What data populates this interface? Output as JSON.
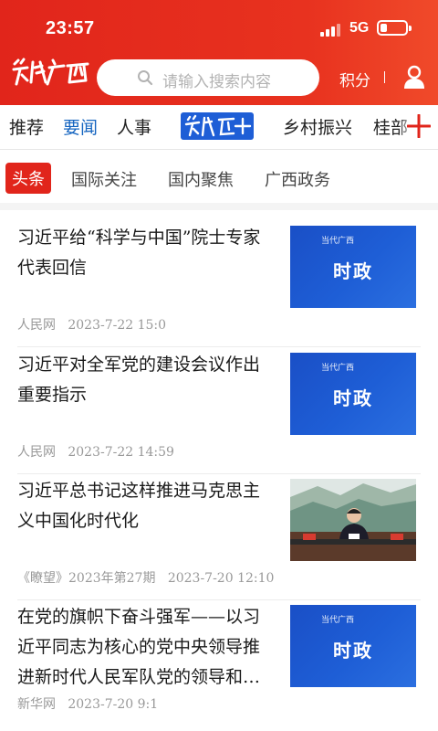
{
  "status": {
    "time": "23:57",
    "network": "5G"
  },
  "header": {
    "logo_text": "当代广西",
    "search_placeholder": "请输入搜索内容",
    "points_label": "积分"
  },
  "channels": {
    "items": [
      "推荐",
      "要闻",
      "人事",
      "乡村振兴",
      "桂部"
    ],
    "active": "要闻",
    "center_logo": "当代+"
  },
  "subtabs": {
    "items": [
      "头条",
      "国际关注",
      "国内聚焦",
      "广西政务"
    ],
    "active": "头条"
  },
  "news": [
    {
      "title": "习近平给“科学与中国”院士专家代表回信",
      "source": "人民网",
      "date": "2023-7-22 15:0",
      "thumb": "时政"
    },
    {
      "title": "习近平对全军党的建设会议作出重要指示",
      "source": "人民网",
      "date": "2023-7-22 14:59",
      "thumb": "时政"
    },
    {
      "title": "习近平总书记这样推进马克思主义中国化时代化",
      "source": "《瞭望》2023年第27期",
      "date": "2023-7-20 12:10",
      "thumb": "photo"
    },
    {
      "title": "在党的旗帜下奋斗强军——以习近平同志为核心的党中央领导推进新时代人民军队党的领导和…",
      "source": "新华网",
      "date": "2023-7-20 9:1",
      "thumb": "时政"
    }
  ],
  "thumb_brand": "当代广西",
  "colors": {
    "brand_red": "#e1251b",
    "active_blue": "#1565c0",
    "thumb_blue": "#1e5ed6"
  }
}
